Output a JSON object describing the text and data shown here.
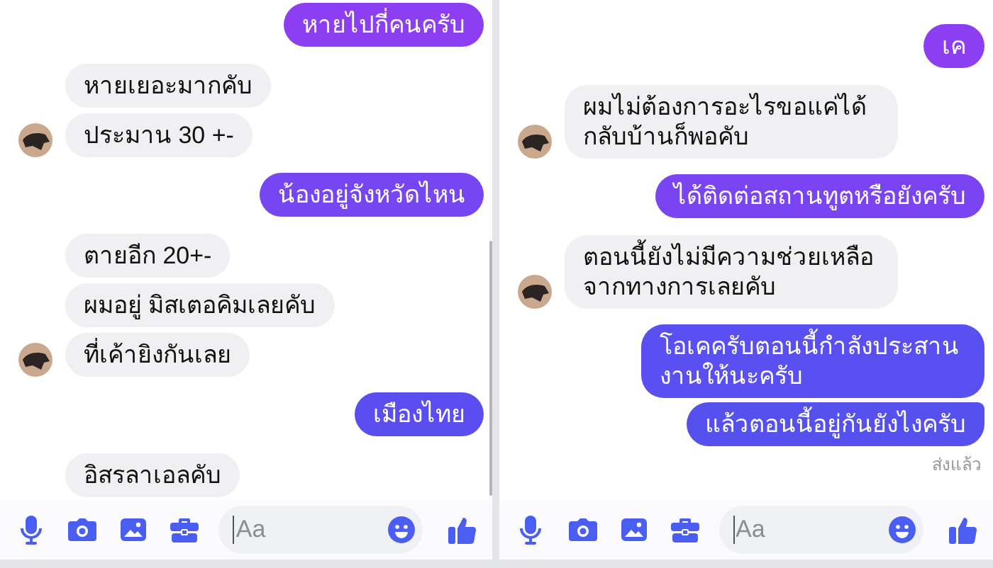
{
  "panels": [
    {
      "messages": [
        {
          "kind": "outgoing",
          "text": "หายไปกี่คนครับ",
          "color": "#8b3ef2"
        },
        {
          "kind": "incoming",
          "bubbles": [
            "หายเยอะมากคับ",
            "ประมาน 30 +-"
          ]
        },
        {
          "kind": "outgoing",
          "text": "น้องอยู่จังหวัดไหน",
          "color": "#7646f2"
        },
        {
          "kind": "incoming",
          "bubbles": [
            "ตายอีก 20+-",
            "ผมอยู่ มิสเตอคิมเลยคับ",
            "ที่เค้ายิงกันเลย"
          ]
        },
        {
          "kind": "outgoing",
          "text": "เมืองไทย",
          "color": "#5a4ef0"
        },
        {
          "kind": "incoming",
          "bubbles": [
            "อิสรลาเอลคับ"
          ],
          "avatar": false
        }
      ],
      "scrollbar": true,
      "composer": {
        "placeholder": "Aa"
      }
    },
    {
      "messages": [
        {
          "kind": "outgoing",
          "text": "เค",
          "color": "#8b3ef2"
        },
        {
          "kind": "incoming",
          "bubbles": [
            "ผมไม่ต้องการอะไรขอแค่ได้กลับบ้านก็พอคับ"
          ]
        },
        {
          "kind": "outgoing",
          "text": "ได้ติดต่อสถานทูตหรือยังครับ",
          "color": "#7a44f2"
        },
        {
          "kind": "incoming",
          "bubbles": [
            "ตอนนี้ยังไม่มีความช่วยเหลือจากทางการเลยคับ"
          ]
        },
        {
          "kind": "outgoing",
          "text": "โอเคครับตอนนี้กำลังประสานงานให้นะครับ",
          "color": "#5a4ff0"
        },
        {
          "kind": "outgoing",
          "text": "แล้วตอนนี้อยู่กันยังไงครับ",
          "color": "#5650ee",
          "joined": true
        },
        {
          "kind": "status",
          "text": "ส่งแล้ว"
        }
      ],
      "scrollbar": false,
      "composer": {
        "placeholder": "Aa"
      }
    }
  ]
}
